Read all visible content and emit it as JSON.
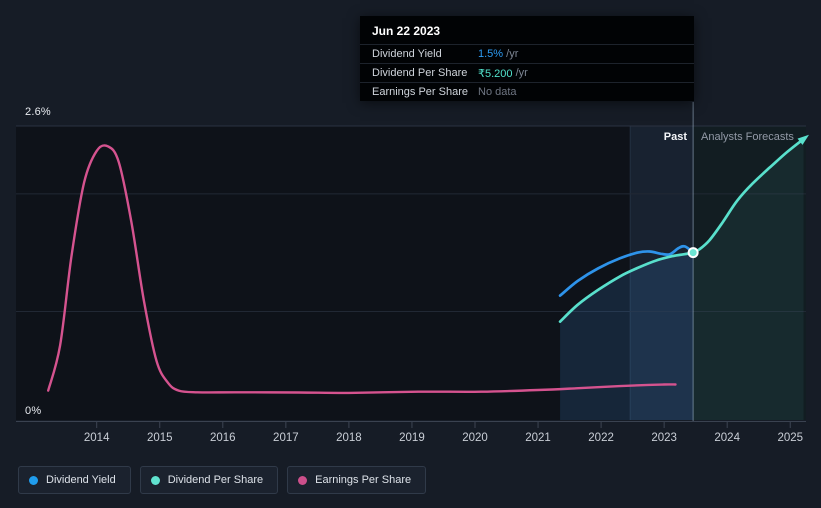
{
  "tooltip": {
    "date": "Jun 22 2023",
    "rows": [
      {
        "label": "Dividend Yield",
        "value": "1.5%",
        "suffix": " /yr",
        "value_color": "#2e9df5"
      },
      {
        "label": "Dividend Per Share",
        "value": "₹5.200",
        "suffix": " /yr",
        "value_color": "#52e2cc"
      },
      {
        "label": "Earnings Per Share",
        "value": "No data",
        "suffix": "",
        "value_color": "#6f7683"
      }
    ]
  },
  "chart": {
    "past_label": "Past",
    "forecast_label": "Analysts Forecasts",
    "y_top_label": "2.6%",
    "y_bottom_label": "0%"
  },
  "legend": {
    "items": [
      {
        "label": "Dividend Yield",
        "color": "#1f9ced"
      },
      {
        "label": "Dividend Per Share",
        "color": "#60e2cf"
      },
      {
        "label": "Earnings Per Share",
        "color": "#cc4f8b"
      }
    ]
  },
  "chart_data": {
    "type": "line",
    "title": "Dividend history and forecast",
    "x_ticks": [
      2014,
      2015,
      2016,
      2017,
      2018,
      2019,
      2020,
      2021,
      2022,
      2023,
      2024,
      2025
    ],
    "x_range": [
      2012.72,
      2025.25
    ],
    "y_axis": {
      "min": 0,
      "max": 2.6,
      "unit": "%",
      "tick_labels": [
        "2.6%",
        "0%"
      ],
      "gridlines_pct": [
        2.6,
        2.0,
        0.96
      ]
    },
    "grid": true,
    "legend_position": "bottom",
    "today_x": 2023.46,
    "past_band_years": 1,
    "marker": {
      "x": 2023.46,
      "y": 1.48,
      "series": "Dividend Per Share"
    },
    "series": [
      {
        "name": "Dividend Yield",
        "color": "#2e93ea",
        "region": "past",
        "points": [
          [
            2021.35,
            1.1
          ],
          [
            2021.63,
            1.23
          ],
          [
            2021.95,
            1.34
          ],
          [
            2022.3,
            1.43
          ],
          [
            2022.58,
            1.48
          ],
          [
            2022.77,
            1.49
          ],
          [
            2022.95,
            1.47
          ],
          [
            2023.09,
            1.465
          ],
          [
            2023.23,
            1.52
          ],
          [
            2023.33,
            1.535
          ],
          [
            2023.46,
            1.48
          ]
        ]
      },
      {
        "name": "Dividend Per Share",
        "color": "#59e0cc",
        "points_past": [
          [
            2021.35,
            0.87
          ],
          [
            2021.63,
            1.02
          ],
          [
            2021.95,
            1.15
          ],
          [
            2022.3,
            1.27
          ],
          [
            2022.58,
            1.345
          ],
          [
            2022.87,
            1.41
          ],
          [
            2023.14,
            1.45
          ],
          [
            2023.31,
            1.465
          ],
          [
            2023.46,
            1.48
          ]
        ],
        "points_forecast": [
          [
            2023.46,
            1.48
          ],
          [
            2023.56,
            1.51
          ],
          [
            2023.72,
            1.59
          ],
          [
            2023.93,
            1.75
          ],
          [
            2024.16,
            1.94
          ],
          [
            2024.4,
            2.09
          ],
          [
            2024.67,
            2.23
          ],
          [
            2024.95,
            2.37
          ],
          [
            2025.21,
            2.485
          ]
        ]
      },
      {
        "name": "Earnings Per Share",
        "color": "#d5538f",
        "region": "past",
        "points": [
          [
            2013.23,
            0.26
          ],
          [
            2013.42,
            0.66
          ],
          [
            2013.6,
            1.45
          ],
          [
            2013.8,
            2.1
          ],
          [
            2014.0,
            2.38
          ],
          [
            2014.18,
            2.42
          ],
          [
            2014.35,
            2.28
          ],
          [
            2014.55,
            1.75
          ],
          [
            2014.75,
            1.05
          ],
          [
            2014.95,
            0.52
          ],
          [
            2015.13,
            0.33
          ],
          [
            2015.3,
            0.26
          ],
          [
            2015.6,
            0.245
          ],
          [
            2016.2,
            0.245
          ],
          [
            2017.2,
            0.243
          ],
          [
            2018.0,
            0.24
          ],
          [
            2019.1,
            0.25
          ],
          [
            2020.1,
            0.25
          ],
          [
            2021.0,
            0.265
          ],
          [
            2021.6,
            0.28
          ],
          [
            2022.3,
            0.3
          ],
          [
            2022.75,
            0.31
          ],
          [
            2023.0,
            0.314
          ],
          [
            2023.18,
            0.314
          ]
        ]
      }
    ]
  }
}
